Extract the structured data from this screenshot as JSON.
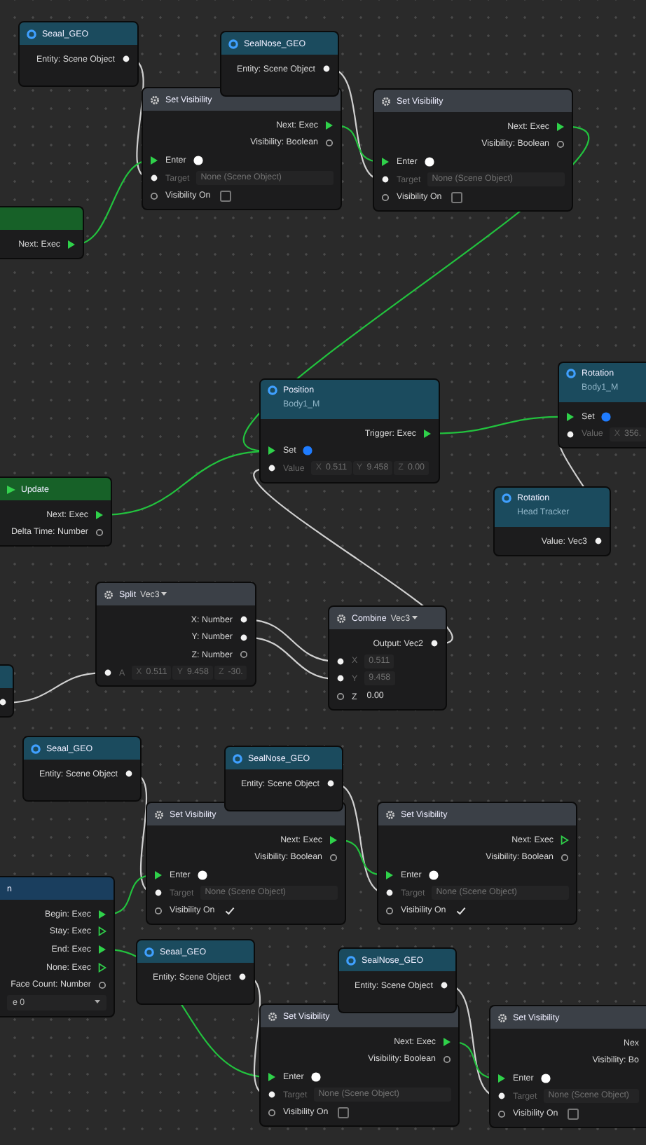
{
  "nodes": [
    {
      "kind": "scene_object",
      "title": "Seaal_GEO",
      "rows": [
        {
          "kind": "data_out",
          "connected": true,
          "label": "Entity: Scene Object"
        }
      ]
    },
    {
      "kind": "scene_object",
      "title": "SealNose_GEO",
      "rows": [
        {
          "kind": "data_out",
          "connected": true,
          "label": "Entity: Scene Object"
        }
      ]
    },
    {
      "kind": "action",
      "title": "Set Visibility",
      "rows": [
        {
          "kind": "exec_out",
          "connected": true,
          "label": "Next: Exec"
        },
        {
          "kind": "data_out",
          "connected": false,
          "label": "Visibility: Boolean"
        },
        {
          "kind": "exec_in",
          "connected": true,
          "label": "Enter",
          "color": "#ffffff"
        },
        {
          "kind": "data_in",
          "connected": true,
          "label": "Target",
          "value": "None (Scene Object)"
        },
        {
          "kind": "data_in",
          "connected": false,
          "label": "Visibility On",
          "checked": false
        }
      ]
    },
    {
      "kind": "action",
      "title": "Set Visibility",
      "rows": [
        {
          "kind": "exec_out",
          "connected": true,
          "label": "Next: Exec"
        },
        {
          "kind": "data_out",
          "connected": false,
          "label": "Visibility: Boolean"
        },
        {
          "kind": "exec_in",
          "connected": true,
          "label": "Enter",
          "color": "#ffffff"
        },
        {
          "kind": "data_in",
          "connected": true,
          "label": "Target",
          "value": "None (Scene Object)"
        },
        {
          "kind": "data_in",
          "connected": false,
          "label": "Visibility On",
          "checked": false
        }
      ]
    },
    {
      "kind": "event",
      "rows": [
        {
          "kind": "exec_out",
          "connected": true,
          "label": "Next: Exec"
        }
      ]
    },
    {
      "kind": "property",
      "title": "Position",
      "subtitle": "Body1_M",
      "rows": [
        {
          "kind": "exec_out",
          "connected": true,
          "label": "Trigger: Exec"
        },
        {
          "kind": "exec_in",
          "connected": true,
          "label": "Set",
          "color": "#1f7cff"
        },
        {
          "kind": "data_in",
          "connected": true,
          "label": "Value",
          "components": [
            {
              "axis": "X",
              "value": "0.511"
            },
            {
              "axis": "Y",
              "value": "9.458"
            },
            {
              "axis": "Z",
              "value": "0.00"
            }
          ]
        }
      ]
    },
    {
      "kind": "property",
      "title": "Rotation",
      "subtitle": "Body1_M",
      "rows": [
        {
          "kind": "exec_in",
          "connected": true,
          "label": "Set",
          "color": "#1f7cff"
        },
        {
          "kind": "data_in",
          "connected": true,
          "label": "Value",
          "components": [
            {
              "axis": "X",
              "value": "356."
            }
          ]
        }
      ]
    },
    {
      "kind": "property",
      "title": "Rotation",
      "subtitle": "Head Tracker",
      "rows": [
        {
          "kind": "data_out",
          "connected": true,
          "label": "Value: Vec3"
        }
      ]
    },
    {
      "kind": "event",
      "title": "Update",
      "rows": [
        {
          "kind": "exec_out",
          "connected": true,
          "label": "Next: Exec"
        },
        {
          "kind": "data_out",
          "connected": false,
          "label": "Delta Time: Number"
        }
      ]
    },
    {
      "kind": "math",
      "title": "Split",
      "type": "Vec3",
      "rows": [
        {
          "kind": "data_out",
          "connected": true,
          "label": "X: Number"
        },
        {
          "kind": "data_out",
          "connected": true,
          "label": "Y: Number"
        },
        {
          "kind": "data_out",
          "connected": false,
          "label": "Z: Number"
        },
        {
          "kind": "data_in",
          "connected": true,
          "label": "A",
          "components": [
            {
              "axis": "X",
              "value": "0.511"
            },
            {
              "axis": "Y",
              "value": "9.458"
            },
            {
              "axis": "Z",
              "value": "-30."
            }
          ]
        }
      ]
    },
    {
      "kind": "math",
      "title": "Combine",
      "type": "Vec3",
      "rows": [
        {
          "kind": "data_out",
          "connected": true,
          "label": "Output: Vec2"
        },
        {
          "kind": "data_in",
          "connected": true,
          "label": "X",
          "value": "0.511"
        },
        {
          "kind": "data_in",
          "connected": true,
          "label": "Y",
          "value": "9.458"
        },
        {
          "kind": "data_in",
          "connected": false,
          "label": "Z",
          "value": "0.00"
        }
      ]
    },
    {
      "kind": "property",
      "rows": [
        {
          "kind": "data_out",
          "connected": true
        }
      ]
    },
    {
      "kind": "scene_object",
      "title": "Seaal_GEO",
      "rows": [
        {
          "kind": "data_out",
          "connected": true,
          "label": "Entity: Scene Object"
        }
      ]
    },
    {
      "kind": "scene_object",
      "title": "SealNose_GEO",
      "rows": [
        {
          "kind": "data_out",
          "connected": true,
          "label": "Entity: Scene Object"
        }
      ]
    },
    {
      "kind": "action",
      "title": "Set Visibility",
      "rows": [
        {
          "kind": "exec_out",
          "connected": true,
          "label": "Next: Exec"
        },
        {
          "kind": "data_out",
          "connected": false,
          "label": "Visibility: Boolean"
        },
        {
          "kind": "exec_in",
          "connected": true,
          "label": "Enter",
          "color": "#ffffff"
        },
        {
          "kind": "data_in",
          "connected": true,
          "label": "Target",
          "value": "None (Scene Object)"
        },
        {
          "kind": "data_in",
          "connected": false,
          "label": "Visibility On",
          "checked": true
        }
      ]
    },
    {
      "kind": "action",
      "title": "Set Visibility",
      "rows": [
        {
          "kind": "exec_out",
          "connected": false,
          "label": "Next: Exec"
        },
        {
          "kind": "data_out",
          "connected": false,
          "label": "Visibility: Boolean"
        },
        {
          "kind": "exec_in",
          "connected": true,
          "label": "Enter",
          "color": "#ffffff"
        },
        {
          "kind": "data_in",
          "connected": true,
          "label": "Target",
          "value": "None (Scene Object)"
        },
        {
          "kind": "data_in",
          "connected": false,
          "label": "Visibility On",
          "checked": true
        }
      ]
    },
    {
      "kind": "trigger",
      "title": "n",
      "rows": [
        {
          "kind": "exec_out",
          "connected": true,
          "label": "Begin: Exec"
        },
        {
          "kind": "exec_out",
          "connected": false,
          "label": "Stay: Exec"
        },
        {
          "kind": "exec_out",
          "connected": true,
          "label": "End: Exec"
        },
        {
          "kind": "exec_out",
          "connected": false,
          "label": "None: Exec"
        },
        {
          "kind": "data_out",
          "connected": false,
          "label": "Face Count: Number"
        },
        {
          "kind": "dropdown",
          "value": "e 0"
        }
      ]
    },
    {
      "kind": "scene_object",
      "title": "Seaal_GEO",
      "rows": [
        {
          "kind": "data_out",
          "connected": true,
          "label": "Entity: Scene Object"
        }
      ]
    },
    {
      "kind": "scene_object",
      "title": "SealNose_GEO",
      "rows": [
        {
          "kind": "data_out",
          "connected": true,
          "label": "Entity: Scene Object"
        }
      ]
    },
    {
      "kind": "action",
      "title": "Set Visibility",
      "rows": [
        {
          "kind": "exec_out",
          "connected": true,
          "label": "Next: Exec"
        },
        {
          "kind": "data_out",
          "connected": false,
          "label": "Visibility: Boolean"
        },
        {
          "kind": "exec_in",
          "connected": true,
          "label": "Enter",
          "color": "#ffffff"
        },
        {
          "kind": "data_in",
          "connected": true,
          "label": "Target",
          "value": "None (Scene Object)"
        },
        {
          "kind": "data_in",
          "connected": false,
          "label": "Visibility On",
          "checked": false
        }
      ]
    },
    {
      "kind": "action",
      "title": "Set Visibility",
      "rows": [
        {
          "kind": "out",
          "label": "Nex"
        },
        {
          "kind": "out",
          "label": "Visibility: Bo"
        },
        {
          "kind": "exec_in",
          "connected": true,
          "label": "Enter",
          "color": "#ffffff"
        },
        {
          "kind": "data_in",
          "connected": true,
          "label": "Target",
          "value": "None (Scene Object)"
        },
        {
          "kind": "data_in",
          "connected": false,
          "label": "Visibility On",
          "checked": false
        }
      ]
    }
  ]
}
